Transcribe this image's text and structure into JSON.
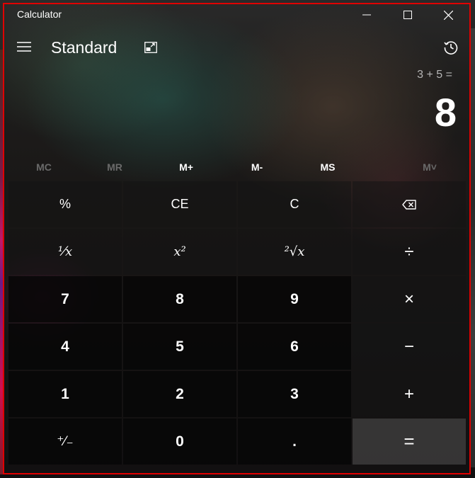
{
  "window": {
    "title": "Calculator"
  },
  "header": {
    "mode": "Standard"
  },
  "display": {
    "expression": "3 + 5 =",
    "result": "8"
  },
  "memory": [
    {
      "label": "MC",
      "enabled": false
    },
    {
      "label": "MR",
      "enabled": false
    },
    {
      "label": "M+",
      "enabled": true
    },
    {
      "label": "M-",
      "enabled": true
    },
    {
      "label": "MS",
      "enabled": true
    },
    {
      "label": "M˅",
      "enabled": false
    }
  ],
  "keys": {
    "percent": "%",
    "ce": "CE",
    "c": "C",
    "reciprocal": "¹⁄x",
    "square": "x²",
    "sqrt": "²√x",
    "divide": "÷",
    "seven": "7",
    "eight": "8",
    "nine": "9",
    "multiply": "×",
    "four": "4",
    "five": "5",
    "six": "6",
    "minus": "−",
    "one": "1",
    "two": "2",
    "three": "3",
    "plus": "+",
    "negate": "⁺⁄₋",
    "zero": "0",
    "decimal": ".",
    "equals": "="
  },
  "icons": {
    "hamburger": "hamburger-icon",
    "keep_on_top": "keep-on-top-icon",
    "history": "history-icon",
    "backspace": "backspace-icon",
    "minimize": "minimize-icon",
    "maximize": "maximize-icon",
    "close": "close-icon"
  }
}
